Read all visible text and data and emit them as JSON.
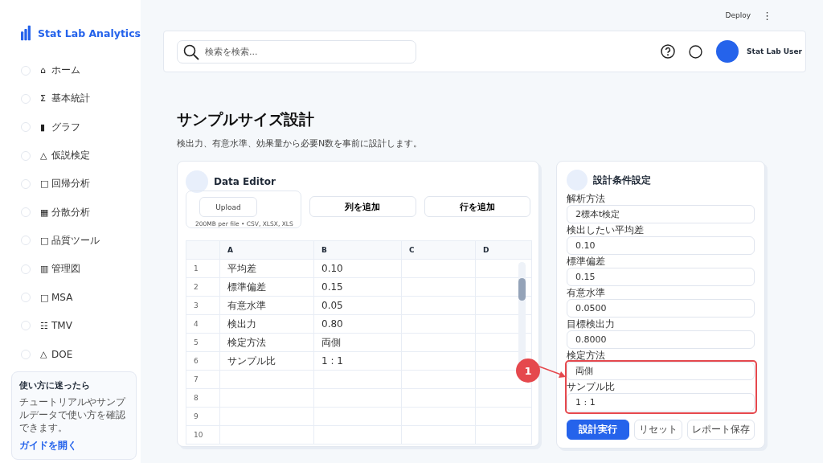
{
  "app": {
    "name": "Stat Lab Analytics"
  },
  "sidebar": {
    "items": [
      {
        "icon": "⌂",
        "label": "ホーム"
      },
      {
        "icon": "Σ",
        "label": "基本統計"
      },
      {
        "icon": "▮",
        "label": "グラフ"
      },
      {
        "icon": "△",
        "label": "仮説検定"
      },
      {
        "icon": "□",
        "label": "回帰分析"
      },
      {
        "icon": "▦",
        "label": "分散分析"
      },
      {
        "icon": "□",
        "label": "品質ツール"
      },
      {
        "icon": "▥",
        "label": "管理図"
      },
      {
        "icon": "□",
        "label": "MSA"
      },
      {
        "icon": "☷",
        "label": "TMV"
      },
      {
        "icon": "△",
        "label": "DOE"
      }
    ]
  },
  "help_card": {
    "title": "使い方に迷ったら",
    "text": "チュートリアルやサンプルデータで使い方を確認できます。",
    "link": "ガイドを開く"
  },
  "top_bar": {
    "deploy": "Deploy",
    "menu": "⋮"
  },
  "header": {
    "search": {
      "placeholder": "検索を検索..."
    },
    "user": {
      "name": "Stat Lab User"
    }
  },
  "page": {
    "title": "サンプルサイズ設計",
    "subtitle": "検出力、有意水準、効果量から必要N数を事前に設計します。"
  },
  "data_editor": {
    "title": "Data Editor",
    "upload": {
      "button": "Upload",
      "caption": "200MB per file • CSV, XLSX, XLS"
    },
    "buttons": [
      "列を追加",
      "行を追加"
    ],
    "table": {
      "columns": [
        "A",
        "B",
        "C",
        "D"
      ],
      "rows": [
        {
          "index": "1",
          "cells": [
            "平均差",
            "0.10"
          ]
        },
        {
          "index": "2",
          "cells": [
            "標準偏差",
            "0.15"
          ]
        },
        {
          "index": "3",
          "cells": [
            "有意水準",
            "0.05"
          ]
        },
        {
          "index": "4",
          "cells": [
            "検出力",
            "0.80"
          ]
        },
        {
          "index": "5",
          "cells": [
            "検定方法",
            "両側"
          ]
        },
        {
          "index": "6",
          "cells": [
            "サンプル比",
            "1 : 1"
          ]
        },
        {
          "index": "7"
        },
        {
          "index": "8"
        },
        {
          "index": "9"
        },
        {
          "index": "10"
        }
      ]
    }
  },
  "settings": {
    "title": "設計条件設定",
    "fields": [
      {
        "label": "解析方法",
        "value": "2標本t検定"
      },
      {
        "label": "検出したい平均差",
        "value": "0.10"
      },
      {
        "label": "標準偏差",
        "value": "0.15"
      },
      {
        "label": "有意水準",
        "value": "0.0500"
      },
      {
        "label": "目標検出力",
        "value": "0.8000"
      },
      {
        "label": "検定方法",
        "value": "両側",
        "annotated": true
      },
      {
        "label": "サンプル比",
        "value": "1 : 1",
        "annotated": true
      }
    ],
    "buttons": [
      {
        "label": "設計実行",
        "kind": "primary"
      },
      {
        "label": "リセット",
        "kind": "secondary"
      },
      {
        "label": "レポート保存",
        "kind": "secondary"
      }
    ]
  },
  "annotation": {
    "number": "1"
  }
}
